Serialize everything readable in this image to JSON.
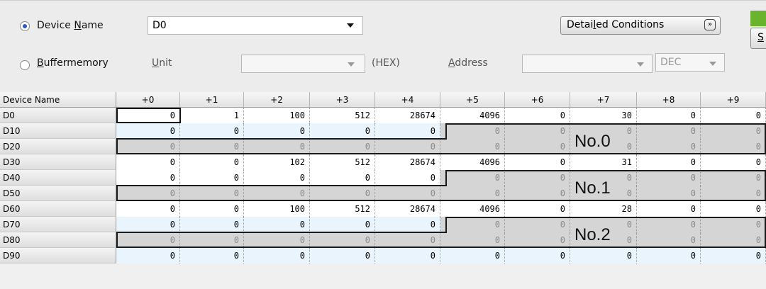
{
  "device_radio": {
    "pre": "Device ",
    "accel": "N",
    "post": "ame"
  },
  "device_value": "D0",
  "buffer_radio": {
    "accel": "B",
    "post": "uffermemory"
  },
  "unit": {
    "accel": "U",
    "post": "nit"
  },
  "hex_label": "(HEX)",
  "address": {
    "accel": "A",
    "post": "ddress"
  },
  "dec_option": "DEC",
  "detailed_button": {
    "pre": "Detai",
    "accel": "l",
    "post": "ed Conditions"
  },
  "cut_button": "S",
  "columns": {
    "corner": "Device Name",
    "headers": [
      "+0",
      "+1",
      "+2",
      "+3",
      "+4",
      "+5",
      "+6",
      "+7",
      "+8",
      "+9"
    ]
  },
  "rows": [
    {
      "label": "D0",
      "values": [
        "0",
        "1",
        "100",
        "512",
        "28674",
        "4096",
        "0",
        "30",
        "0",
        "0"
      ]
    },
    {
      "label": "D10",
      "values": [
        "0",
        "0",
        "0",
        "0",
        "0",
        "0",
        "0",
        "0",
        "0",
        "0"
      ]
    },
    {
      "label": "D20",
      "values": [
        "0",
        "0",
        "0",
        "0",
        "0",
        "0",
        "0",
        "0",
        "0",
        "0"
      ]
    },
    {
      "label": "D30",
      "values": [
        "0",
        "0",
        "102",
        "512",
        "28674",
        "4096",
        "0",
        "31",
        "0",
        "0"
      ]
    },
    {
      "label": "D40",
      "values": [
        "0",
        "0",
        "0",
        "0",
        "0",
        "0",
        "0",
        "0",
        "0",
        "0"
      ]
    },
    {
      "label": "D50",
      "values": [
        "0",
        "0",
        "0",
        "0",
        "0",
        "0",
        "0",
        "0",
        "0",
        "0"
      ]
    },
    {
      "label": "D60",
      "values": [
        "0",
        "0",
        "100",
        "512",
        "28674",
        "4096",
        "0",
        "28",
        "0",
        "0"
      ]
    },
    {
      "label": "D70",
      "values": [
        "0",
        "0",
        "0",
        "0",
        "0",
        "0",
        "0",
        "0",
        "0",
        "0"
      ]
    },
    {
      "label": "D80",
      "values": [
        "0",
        "0",
        "0",
        "0",
        "0",
        "0",
        "0",
        "0",
        "0",
        "0"
      ]
    },
    {
      "label": "D90",
      "values": [
        "0",
        "0",
        "0",
        "0",
        "0",
        "0",
        "0",
        "0",
        "0",
        "0"
      ]
    }
  ],
  "blocks": [
    "No.0",
    "No.1",
    "No.2"
  ],
  "colors": {
    "selected_row": "#ffffff",
    "data_row": "#eaf4fd",
    "grey_cell": "#d5d5d5",
    "green_indicator": "#6ab42d"
  }
}
